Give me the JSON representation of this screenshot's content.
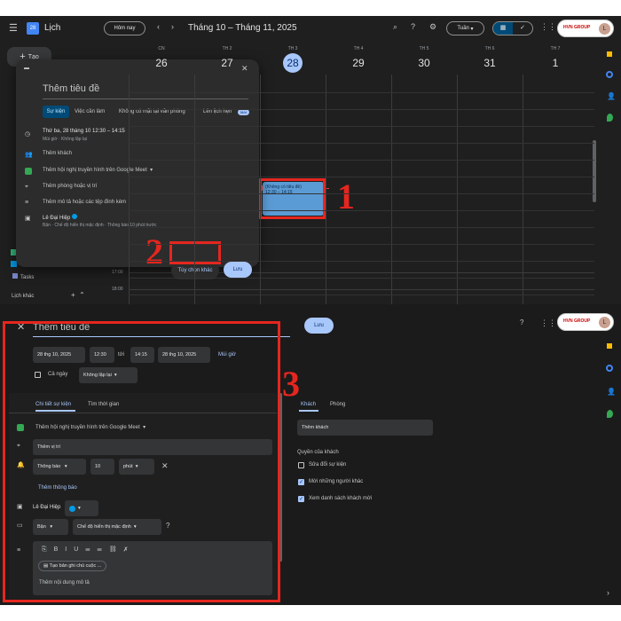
{
  "top": {
    "header": {
      "app_title": "Lịch",
      "today_btn": "Hôm nay",
      "date_range": "Tháng 10 – Tháng 11, 2025",
      "view": "Tuần",
      "brand": "HVN GROUP",
      "avatar": "L"
    },
    "create_btn": "Tạo",
    "days": [
      {
        "dow": "CN",
        "num": "26"
      },
      {
        "dow": "TH 2",
        "num": "27"
      },
      {
        "dow": "TH 3",
        "num": "28"
      },
      {
        "dow": "TH 4",
        "num": "29"
      },
      {
        "dow": "TH 5",
        "num": "30"
      },
      {
        "dow": "TH 6",
        "num": "31"
      },
      {
        "dow": "TH 7",
        "num": "1"
      }
    ],
    "times": [
      "17:00",
      "18:00"
    ],
    "event": {
      "title": "(Không có tiêu đề)",
      "time": "12:30 – 14:15"
    },
    "sidebar": {
      "tasks": "Tasks",
      "other_calendars": "Lịch khác"
    },
    "dialog": {
      "title_placeholder": "Thêm tiêu đề",
      "tabs": [
        "Sự kiện",
        "Việc cần làm",
        "Không có mặt tại văn phòng",
        "Lên lịch hẹn"
      ],
      "new_badge": "Mới",
      "datetime": "Thứ ba, 28 tháng 10    12:30  –  14:15",
      "timezone": "Múi giờ · Không lặp lại",
      "add_guests": "Thêm khách",
      "meet": "Thêm hội nghị truyền hình trên Google Meet",
      "room": "Thêm phòng hoặc vị trí",
      "description": "Thêm mô tả hoặc các tệp đính kèm",
      "owner": "Lê Đại Hiệp",
      "owner_sub": "Bận · Chế độ hiển thị mặc định · Thông báo 10 phút trước",
      "more_options": "Tùy chọn khác",
      "save": "Lưu"
    }
  },
  "bottom": {
    "title": "Thêm tiêu đề",
    "save": "Lưu",
    "start_date": "28 thg 10, 2025",
    "start_time": "12:30",
    "to": "tới",
    "end_time": "14:15",
    "end_date": "28 thg 10, 2025",
    "timezone": "Múi giờ",
    "all_day": "Cả ngày",
    "repeat": "Không lặp lại",
    "tabs": [
      "Chi tiết sự kiện",
      "Tìm thời gian"
    ],
    "meet": "Thêm hội nghị truyền hình trên Google Meet",
    "location": "Thêm vị trí",
    "notif_type": "Thông báo",
    "notif_value": "10",
    "notif_unit": "phút",
    "add_notif": "Thêm thông báo",
    "calendar_owner": "Lê Đại Hiệp",
    "busy": "Bận",
    "visibility": "Chế độ hiển thị mặc định",
    "notes_btn": "Tạo bản ghi chú cuộc ...",
    "desc_placeholder": "Thêm nội dung mô tả",
    "guest_tabs": [
      "Khách",
      "Phòng"
    ],
    "add_guest": "Thêm khách",
    "guest_perms_title": "Quyền của khách",
    "perms": [
      {
        "label": "Sửa đổi sự kiện",
        "checked": false
      },
      {
        "label": "Mời những người khác",
        "checked": true
      },
      {
        "label": "Xem danh sách khách mời",
        "checked": true
      }
    ],
    "brand": "HVN GROUP",
    "avatar": "L"
  },
  "annotations": [
    "1",
    "2",
    "3"
  ],
  "colors": {
    "accent": "#a8c7fa",
    "event": "#5b9bd5",
    "red": "#e5261f",
    "bg": "#1f1f1f"
  }
}
